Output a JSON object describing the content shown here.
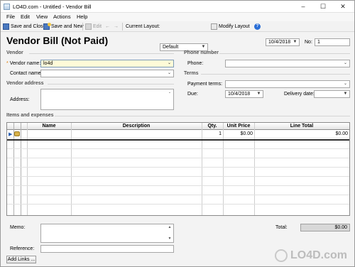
{
  "window": {
    "title": "LO4D.com - Untitled - Vendor Bill",
    "minimize": "–",
    "maximize": "☐",
    "close": "✕"
  },
  "menu": [
    "File",
    "Edit",
    "View",
    "Actions",
    "Help"
  ],
  "toolbar": {
    "save_close": "Save and Close",
    "save_new": "Save and New",
    "edit": "Edit",
    "prev": "←",
    "next": "→",
    "current_layout_label": "Current Layout:",
    "current_layout_value": "Default",
    "modify_layout": "Modify Layout",
    "help": "?"
  },
  "header": {
    "title": "Vendor Bill (Not Paid)",
    "date": "10/4/2018",
    "no_label": "No:",
    "no_value": "1"
  },
  "vendor": {
    "section": "Vendor",
    "name_label": "Vendor name:",
    "name_value": "lo4d",
    "contact_label": "Contact name:",
    "contact_value": ""
  },
  "vendor_address": {
    "section": "Vendor address",
    "address_label": "Address:"
  },
  "phone": {
    "section": "Phone number",
    "label": "Phone:"
  },
  "terms": {
    "section": "Terms",
    "payment_label": "Payment terms:",
    "due_label": "Due:",
    "due_value": "10/4/2018",
    "delivery_label": "Delivery date:"
  },
  "items": {
    "section": "Items and expenses",
    "columns": [
      "Name",
      "Description",
      "Qty.",
      "Unit Price",
      "Line Total"
    ],
    "row": {
      "qty": "1",
      "unit_price": "$0.00",
      "line_total": "$0.00"
    }
  },
  "footer": {
    "memo_label": "Memo:",
    "reference_label": "Reference:",
    "add_links": "Add Links ...",
    "total_label": "Total:",
    "total_value": "$0.00"
  },
  "watermark": "LO4D.com"
}
